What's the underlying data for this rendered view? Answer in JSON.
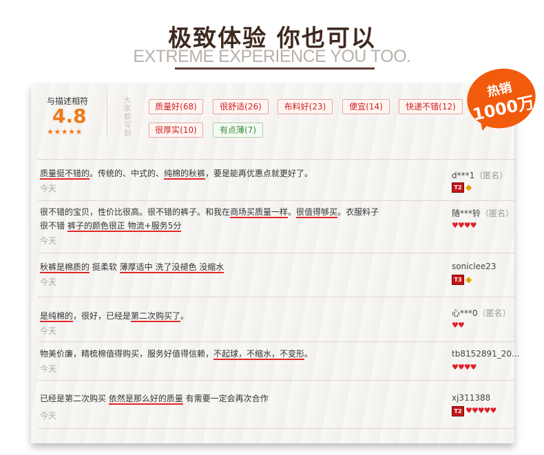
{
  "header": {
    "title": "极致体验 你也可以",
    "subtitle": "EXTREME EXPERIENCE YOU TOO."
  },
  "badge": {
    "line1": "热销",
    "line2": "1000万"
  },
  "rating": {
    "label": "与描述相符",
    "score": "4.8",
    "stars": "★★★★★"
  },
  "dajia_label": [
    "大",
    "家",
    "都",
    "写",
    "到"
  ],
  "tags": [
    "质量好(68)",
    "很舒适(26)",
    "布料好(23)",
    "便宜(14)",
    "快递不错(12)",
    "很厚实(10)",
    "有点薄(7)"
  ],
  "reviews": [
    {
      "parts": [
        "质量挺不错的",
        "。传统的、中式的、",
        "纯棉的秋裤",
        "，要是能再优惠点就更好了。"
      ],
      "date": "今天",
      "user": "d***1",
      "anon": "（匿名）",
      "level": "T2"
    },
    {
      "line1_parts": [
        "很不错的宝贝，性价比很高。很不错的裤子。和我在",
        "商场买质量一样",
        "。",
        "很值得够买",
        "。衣服料子"
      ],
      "line2_parts": [
        "很不错 ",
        "裤子的颜色很正 物流+服务5分"
      ],
      "date": "今天",
      "user": "随***铃",
      "anon": "（匿名）"
    },
    {
      "parts": [
        "秋裤是棉质的",
        " 挺柔软 ",
        "薄厚适中 洗了没褪色 没缩水"
      ],
      "date": "今天",
      "user": "soniclee23",
      "level": "T3"
    },
    {
      "parts": [
        "是纯棉的",
        "，很好，已经是",
        "第二次购买了",
        "。"
      ],
      "date": "今天",
      "user": "心***0",
      "anon": "（匿名）"
    },
    {
      "parts": [
        "物美价廉，精梳棉值得购买，服务好值得信赖，",
        "不起球，不缩水，不变形",
        "。"
      ],
      "date": "今天",
      "user": "tb8152891_20..."
    },
    {
      "parts": [
        "已经是第二次购买 ",
        "依然是那么好的质量",
        " 有需要一定会再次合作"
      ],
      "date": "今天",
      "user": "xj311388",
      "level": "T2"
    }
  ],
  "icons": {
    "vip": "diamond-icon",
    "heart": "heart-icon"
  },
  "colors": {
    "accent": "#f07a1a",
    "badge": "#f25a0c",
    "tag_positive": "#d02020",
    "tag_neutral": "#3a8a3a",
    "title": "#3f2a20"
  }
}
